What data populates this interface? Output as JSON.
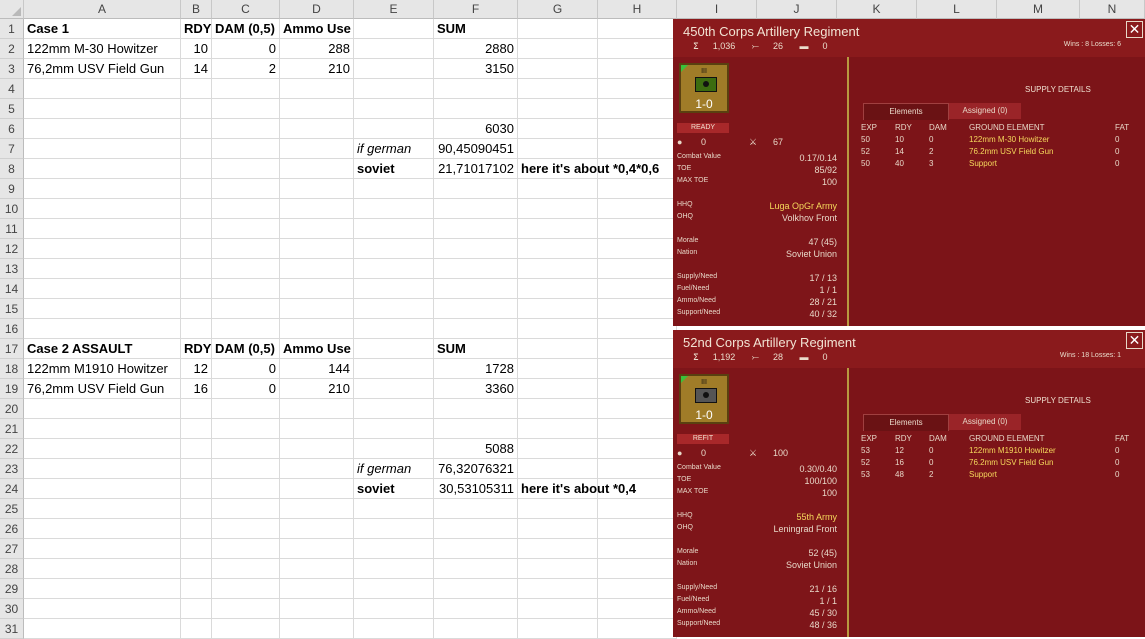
{
  "sheet": {
    "columns": [
      "A",
      "B",
      "C",
      "D",
      "E",
      "F",
      "G",
      "H",
      "I",
      "J",
      "K",
      "L",
      "M",
      "N"
    ],
    "rows": [
      {
        "n": "1",
        "A": "Case 1",
        "B": "RDY",
        "C": "DAM (0,5)",
        "D": "Ammo Use",
        "E": "",
        "F": "SUM",
        "G": ""
      },
      {
        "n": "2",
        "A": "122mm M-30 Howitzer",
        "B": "10",
        "C": "0",
        "D": "288",
        "E": "",
        "F": "2880",
        "G": ""
      },
      {
        "n": "3",
        "A": "76,2mm USV Field Gun",
        "B": "14",
        "C": "2",
        "D": "210",
        "E": "",
        "F": "3150",
        "G": ""
      },
      {
        "n": "4",
        "A": "",
        "B": "",
        "C": "",
        "D": "",
        "E": "",
        "F": "",
        "G": ""
      },
      {
        "n": "5",
        "A": "",
        "B": "",
        "C": "",
        "D": "",
        "E": "",
        "F": "",
        "G": ""
      },
      {
        "n": "6",
        "A": "",
        "B": "",
        "C": "",
        "D": "",
        "E": "",
        "F": "6030",
        "G": ""
      },
      {
        "n": "7",
        "A": "",
        "B": "",
        "C": "",
        "D": "",
        "E": "if german",
        "F": "90,45090451",
        "G": ""
      },
      {
        "n": "8",
        "A": "",
        "B": "",
        "C": "",
        "D": "",
        "E": "soviet",
        "F": "21,71017102",
        "G": "here it's about *0,4*0,6"
      },
      {
        "n": "9",
        "A": "",
        "B": "",
        "C": "",
        "D": "",
        "E": "",
        "F": "",
        "G": ""
      },
      {
        "n": "10",
        "A": "",
        "B": "",
        "C": "",
        "D": "",
        "E": "",
        "F": "",
        "G": ""
      },
      {
        "n": "11",
        "A": "",
        "B": "",
        "C": "",
        "D": "",
        "E": "",
        "F": "",
        "G": ""
      },
      {
        "n": "12",
        "A": "",
        "B": "",
        "C": "",
        "D": "",
        "E": "",
        "F": "",
        "G": ""
      },
      {
        "n": "13",
        "A": "",
        "B": "",
        "C": "",
        "D": "",
        "E": "",
        "F": "",
        "G": ""
      },
      {
        "n": "14",
        "A": "",
        "B": "",
        "C": "",
        "D": "",
        "E": "",
        "F": "",
        "G": ""
      },
      {
        "n": "15",
        "A": "",
        "B": "",
        "C": "",
        "D": "",
        "E": "",
        "F": "",
        "G": ""
      },
      {
        "n": "16",
        "A": "",
        "B": "",
        "C": "",
        "D": "",
        "E": "",
        "F": "",
        "G": ""
      },
      {
        "n": "17",
        "A": "Case 2 ASSAULT",
        "B": "RDY",
        "C": "DAM (0,5)",
        "D": "Ammo Use",
        "E": "",
        "F": "SUM",
        "G": ""
      },
      {
        "n": "18",
        "A": "122mm M1910 Howitzer",
        "B": "12",
        "C": "0",
        "D": "144",
        "E": "",
        "F": "1728",
        "G": ""
      },
      {
        "n": "19",
        "A": "76,2mm USV Field Gun",
        "B": "16",
        "C": "0",
        "D": "210",
        "E": "",
        "F": "3360",
        "G": ""
      },
      {
        "n": "20",
        "A": "",
        "B": "",
        "C": "",
        "D": "",
        "E": "",
        "F": "",
        "G": ""
      },
      {
        "n": "21",
        "A": "",
        "B": "",
        "C": "",
        "D": "",
        "E": "",
        "F": "",
        "G": ""
      },
      {
        "n": "22",
        "A": "",
        "B": "",
        "C": "",
        "D": "",
        "E": "",
        "F": "5088",
        "G": ""
      },
      {
        "n": "23",
        "A": "",
        "B": "",
        "C": "",
        "D": "",
        "E": "if german",
        "F": "76,32076321",
        "G": ""
      },
      {
        "n": "24",
        "A": "",
        "B": "",
        "C": "",
        "D": "",
        "E": "soviet",
        "F": "30,53105311",
        "G": "here it's about *0,4"
      },
      {
        "n": "25",
        "A": "",
        "B": "",
        "C": "",
        "D": "",
        "E": "",
        "F": "",
        "G": ""
      },
      {
        "n": "26",
        "A": "",
        "B": "",
        "C": "",
        "D": "",
        "E": "",
        "F": "",
        "G": ""
      },
      {
        "n": "27",
        "A": "",
        "B": "",
        "C": "",
        "D": "",
        "E": "",
        "F": "",
        "G": ""
      },
      {
        "n": "28",
        "A": "",
        "B": "",
        "C": "",
        "D": "",
        "E": "",
        "F": "",
        "G": ""
      },
      {
        "n": "29",
        "A": "",
        "B": "",
        "C": "",
        "D": "",
        "E": "",
        "F": "",
        "G": ""
      },
      {
        "n": "30",
        "A": "",
        "B": "",
        "C": "",
        "D": "",
        "E": "",
        "F": "",
        "G": ""
      },
      {
        "n": "31",
        "A": "",
        "B": "",
        "C": "",
        "D": "",
        "E": "",
        "F": "",
        "G": ""
      }
    ]
  },
  "panels": [
    {
      "title": "450th Corps Artillery Regiment",
      "men": "1,036",
      "guns": "26",
      "afv": "0",
      "wins": "Wins : 8  Losses: 6",
      "counter_value": "1-0",
      "counter_size": "III",
      "status": "READY",
      "drops": "0",
      "swords": "67",
      "combat_value": "0.17/0.14",
      "toe": "85/92",
      "max_toe": "100",
      "hhq": "Luga OpGr Army",
      "ohq": "Volkhov Front",
      "morale": "47 (45)",
      "nation": "Soviet Union",
      "supply_need": "17 / 13",
      "fuel_need": "1 / 1",
      "ammo_need": "28 / 21",
      "support_need": "40 / 32",
      "labels": {
        "combat_value": "Combat Value",
        "toe": "TOE",
        "max_toe": "MAX TOE",
        "hhq": "HHQ",
        "ohq": "OHQ",
        "morale": "Morale",
        "nation": "Nation",
        "supply": "Supply/Need",
        "fuel": "Fuel/Need",
        "ammo": "Ammo/Need",
        "support": "Support/Need"
      },
      "supply_details": "SUPPLY DETAILS",
      "tab_elements": "Elements",
      "tab_assigned": "Assigned (0)",
      "headers": [
        "EXP",
        "RDY",
        "DAM",
        "GROUND ELEMENT",
        "FAT"
      ],
      "elements": [
        {
          "exp": "50",
          "rdy": "10",
          "dam": "0",
          "name": "122mm M-30 Howitzer",
          "fat": "0"
        },
        {
          "exp": "52",
          "rdy": "14",
          "dam": "2",
          "name": "76.2mm USV Field Gun",
          "fat": "0"
        },
        {
          "exp": "50",
          "rdy": "40",
          "dam": "3",
          "name": "Support",
          "fat": "0"
        }
      ]
    },
    {
      "title": "52nd Corps Artillery Regiment",
      "men": "1,192",
      "guns": "28",
      "afv": "0",
      "wins": "Wins : 18  Losses: 1",
      "counter_value": "1-0",
      "counter_size": "III",
      "status": "REFIT",
      "drops": "0",
      "swords": "100",
      "combat_value": "0.30/0.40",
      "toe": "100/100",
      "max_toe": "100",
      "hhq": "55th Army",
      "ohq": "Leningrad Front",
      "morale": "52 (45)",
      "nation": "Soviet Union",
      "supply_need": "21 / 16",
      "fuel_need": "1 / 1",
      "ammo_need": "45 / 30",
      "support_need": "48 / 36",
      "labels": {
        "combat_value": "Combat Value",
        "toe": "TOE",
        "max_toe": "MAX TOE",
        "hhq": "HHQ",
        "ohq": "OHQ",
        "morale": "Morale",
        "nation": "Nation",
        "supply": "Supply/Need",
        "fuel": "Fuel/Need",
        "ammo": "Ammo/Need",
        "support": "Support/Need"
      },
      "supply_details": "SUPPLY DETAILS",
      "tab_elements": "Elements",
      "tab_assigned": "Assigned (0)",
      "headers": [
        "EXP",
        "RDY",
        "DAM",
        "GROUND ELEMENT",
        "FAT"
      ],
      "elements": [
        {
          "exp": "53",
          "rdy": "12",
          "dam": "0",
          "name": "122mm M1910 Howitzer",
          "fat": "0"
        },
        {
          "exp": "52",
          "rdy": "16",
          "dam": "0",
          "name": "76.2mm USV Field Gun",
          "fat": "0"
        },
        {
          "exp": "53",
          "rdy": "48",
          "dam": "2",
          "name": "Support",
          "fat": "0"
        }
      ]
    }
  ],
  "icons": {
    "close": "✕",
    "men": "men-icon",
    "guns": "gun-icon",
    "afv": "tank-icon",
    "drop": "●",
    "swords": "⚔"
  }
}
